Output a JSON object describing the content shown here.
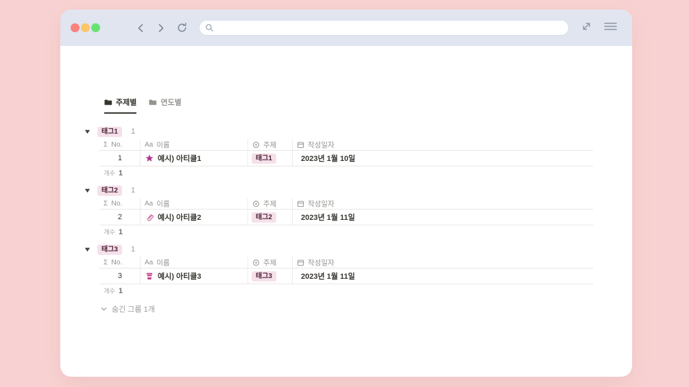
{
  "titlebar": {
    "traffic_lights": [
      {
        "name": "close",
        "color": "#fb817d"
      },
      {
        "name": "minimize",
        "color": "#fcc768"
      },
      {
        "name": "zoom",
        "color": "#69e274"
      }
    ],
    "search": {
      "value": "",
      "placeholder": ""
    }
  },
  "tabs": [
    {
      "label": "주제별",
      "icon": "folder-icon",
      "active": true
    },
    {
      "label": "연도별",
      "icon": "folder-icon",
      "active": false
    }
  ],
  "table": {
    "columns": [
      {
        "icon": "sigma-icon",
        "label": "No."
      },
      {
        "icon": "text-icon",
        "label": "이름"
      },
      {
        "icon": "select-icon",
        "label": "주제"
      },
      {
        "icon": "calendar-icon",
        "label": "작성일자"
      }
    ],
    "groups": [
      {
        "tag": "태그1",
        "count": "1",
        "row": {
          "no": "1",
          "icon": "star-icon",
          "name": "예시) 아티클1",
          "tag": "태그1",
          "date": "2023년 1월 10일"
        },
        "calc_label": "개수",
        "calc_value": "1"
      },
      {
        "tag": "태그2",
        "count": "1",
        "row": {
          "no": "2",
          "icon": "paperclip-icon",
          "name": "예시) 아티클2",
          "tag": "태그2",
          "date": "2023년 1월 11일"
        },
        "calc_label": "개수",
        "calc_value": "1"
      },
      {
        "tag": "태그3",
        "count": "1",
        "row": {
          "no": "3",
          "icon": "cup-icon",
          "name": "예시) 아티클3",
          "tag": "태그3",
          "date": "2023년 1월 11일"
        },
        "calc_label": "개수",
        "calc_value": "1"
      }
    ],
    "hidden_groups_label": "숨긴 그룹 1개"
  },
  "colors": {
    "page_background": "#f8d2d2",
    "titlebar_background": "#e0e5f0",
    "tag_badge_background": "#f5e0e9",
    "tag_badge_text": "#4c2337",
    "star_accent": "#b13a8d",
    "paperclip_accent": "#cf6da4",
    "cup_accent": "#c73f8a",
    "border": "#e9e7e4"
  }
}
